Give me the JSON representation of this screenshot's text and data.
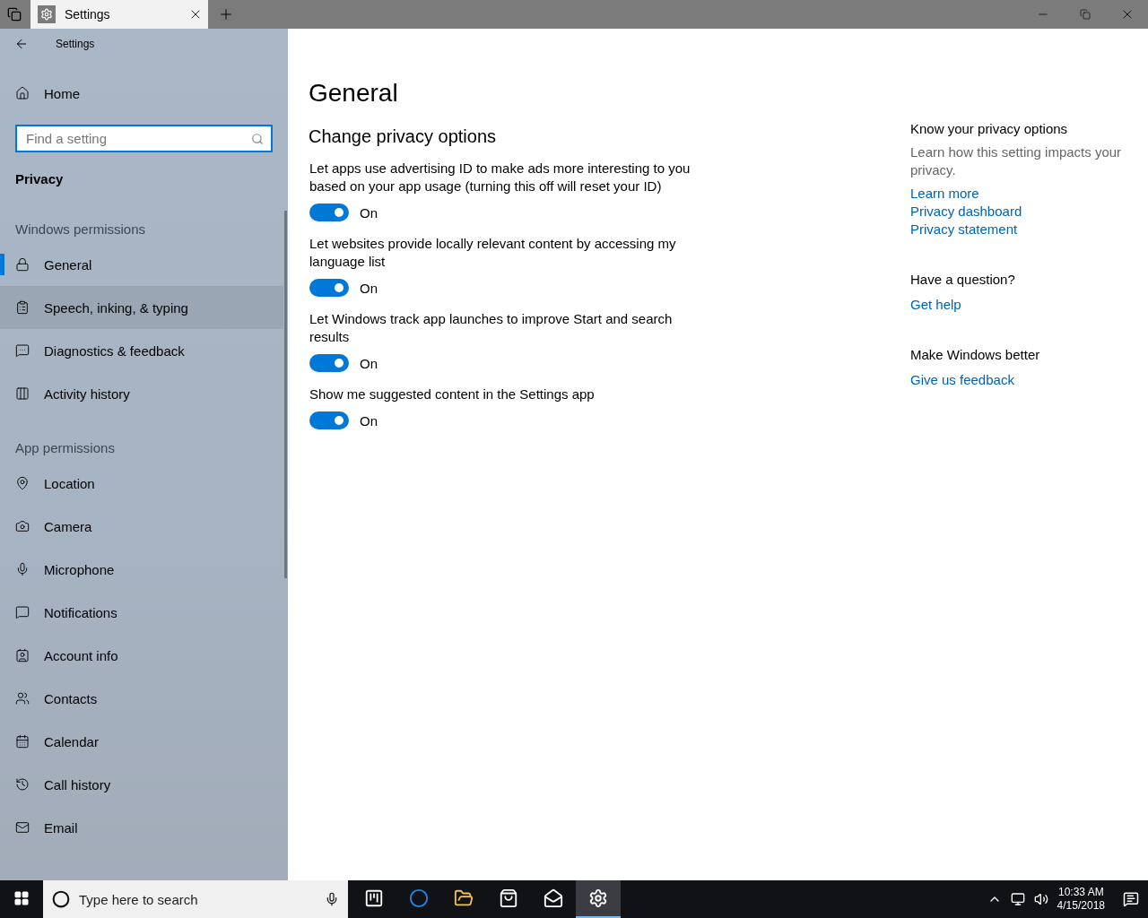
{
  "titlebar": {
    "tab_title": "Settings"
  },
  "sidebar": {
    "header": "Settings",
    "home": "Home",
    "search": {
      "placeholder": "Find a setting"
    },
    "section_title": "Privacy",
    "groups": [
      {
        "title": "Windows permissions",
        "items": [
          {
            "label": "General",
            "selected": true,
            "hovered": false
          },
          {
            "label": "Speech, inking, & typing",
            "selected": false,
            "hovered": true
          },
          {
            "label": "Diagnostics & feedback",
            "selected": false,
            "hovered": false
          },
          {
            "label": "Activity history",
            "selected": false,
            "hovered": false
          }
        ]
      },
      {
        "title": "App permissions",
        "items": [
          {
            "label": "Location",
            "selected": false,
            "hovered": false
          },
          {
            "label": "Camera",
            "selected": false,
            "hovered": false
          },
          {
            "label": "Microphone",
            "selected": false,
            "hovered": false
          },
          {
            "label": "Notifications",
            "selected": false,
            "hovered": false
          },
          {
            "label": "Account info",
            "selected": false,
            "hovered": false
          },
          {
            "label": "Contacts",
            "selected": false,
            "hovered": false
          },
          {
            "label": "Calendar",
            "selected": false,
            "hovered": false
          },
          {
            "label": "Call history",
            "selected": false,
            "hovered": false
          },
          {
            "label": "Email",
            "selected": false,
            "hovered": false
          }
        ]
      }
    ]
  },
  "main": {
    "title": "General",
    "subtitle": "Change privacy options",
    "settings": [
      {
        "label": "Let apps use advertising ID to make ads more interesting to you based on your app usage (turning this off will reset your ID)",
        "on": true,
        "state_label": "On"
      },
      {
        "label": "Let websites provide locally relevant content by accessing my language list",
        "on": true,
        "state_label": "On"
      },
      {
        "label": "Let Windows track app launches to improve Start and search results",
        "on": true,
        "state_label": "On"
      },
      {
        "label": "Show me suggested content in the Settings app",
        "on": true,
        "state_label": "On"
      }
    ]
  },
  "aside": {
    "sections": [
      {
        "title": "Know your privacy options",
        "text": "Learn how this setting impacts your privacy.",
        "links": [
          "Learn more",
          "Privacy dashboard",
          "Privacy statement"
        ]
      },
      {
        "title": "Have a question?",
        "links": [
          "Get help"
        ]
      },
      {
        "title": "Make Windows better",
        "links": [
          "Give us feedback"
        ]
      }
    ]
  },
  "taskbar": {
    "search": {
      "placeholder": "Type here to search"
    },
    "apps": [
      {
        "selected": false
      },
      {
        "selected": false
      },
      {
        "selected": false
      },
      {
        "selected": false
      },
      {
        "selected": false
      },
      {
        "selected": true
      }
    ],
    "time": "10:33 AM",
    "date": "4/15/2018"
  }
}
